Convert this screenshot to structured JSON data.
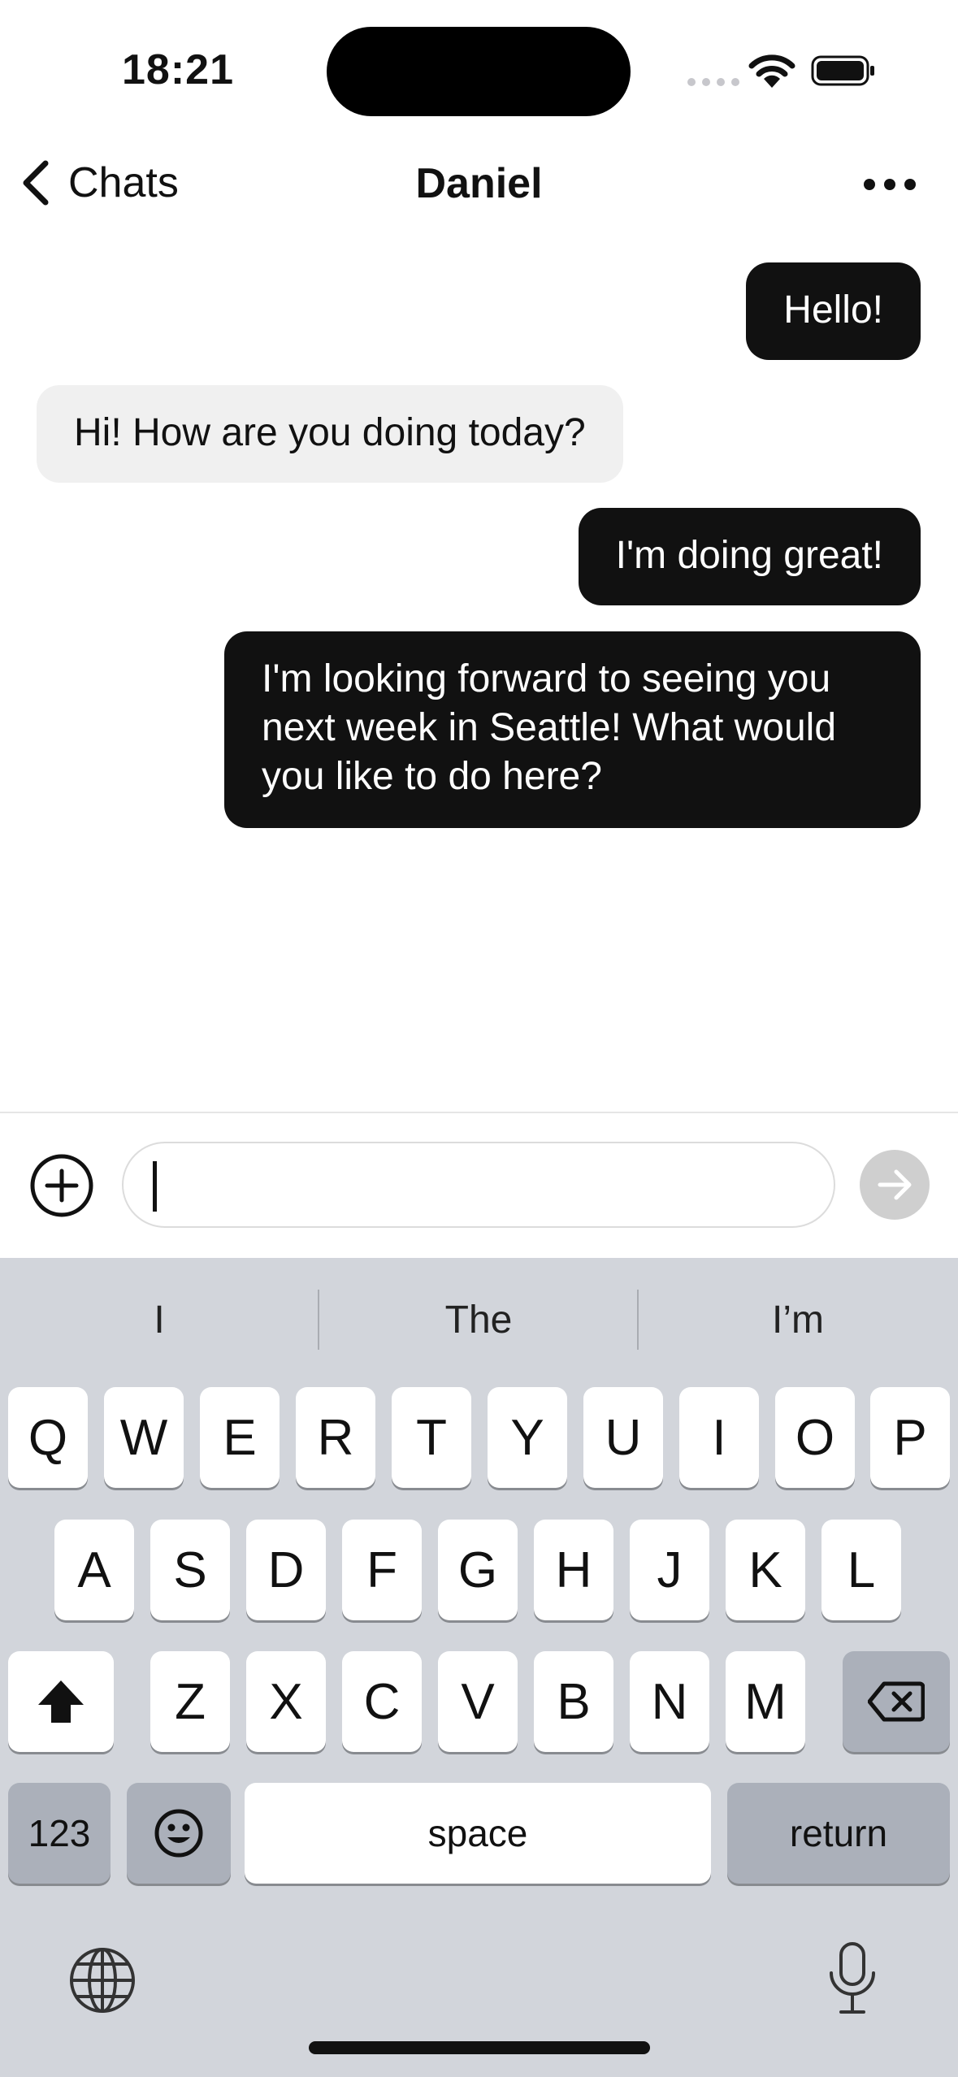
{
  "status": {
    "time": "18:21"
  },
  "nav": {
    "back_label": "Chats",
    "title": "Daniel"
  },
  "messages": [
    {
      "from": "me",
      "text": "Hello!"
    },
    {
      "from": "them",
      "text": "Hi! How are you doing today?"
    },
    {
      "from": "me",
      "text": "I'm doing great!"
    },
    {
      "from": "me",
      "text": "I'm looking forward to seeing you next week in Seattle! What would you like to do here?"
    }
  ],
  "composer": {
    "value": "",
    "placeholder": ""
  },
  "keyboard": {
    "suggestions": [
      "I",
      "The",
      "I’m"
    ],
    "row1": [
      "Q",
      "W",
      "E",
      "R",
      "T",
      "Y",
      "U",
      "I",
      "O",
      "P"
    ],
    "row2": [
      "A",
      "S",
      "D",
      "F",
      "G",
      "H",
      "J",
      "K",
      "L"
    ],
    "row3": [
      "Z",
      "X",
      "C",
      "V",
      "B",
      "N",
      "M"
    ],
    "numbers_label": "123",
    "space_label": "space",
    "return_label": "return"
  },
  "colors": {
    "outgoing_bubble": "#111111",
    "incoming_bubble": "#f0f0f0",
    "keyboard_bg": "#d2d5db",
    "send_button": "#cfcfcf"
  }
}
